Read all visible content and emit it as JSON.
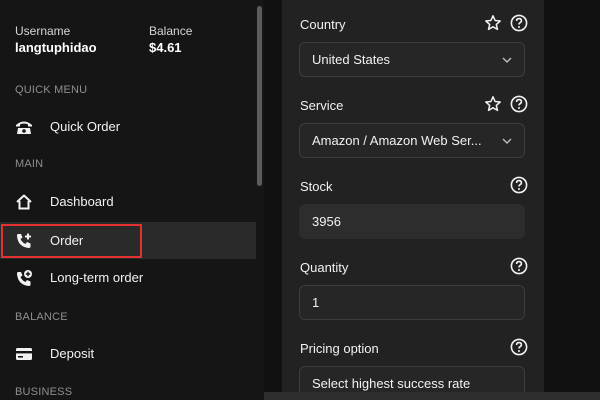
{
  "sidebar": {
    "username_label": "Username",
    "username": "langtuphidao",
    "balance_label": "Balance",
    "balance": "$4.61",
    "sections": {
      "quick_menu": "QUICK MENU",
      "main": "MAIN",
      "balance": "BALANCE",
      "business": "BUSINESS"
    },
    "items": {
      "quick_order": {
        "label": "Quick Order",
        "icon": "phone-icon"
      },
      "dashboard": {
        "label": "Dashboard",
        "icon": "home-icon"
      },
      "order": {
        "label": "Order",
        "icon": "phone-plus-icon"
      },
      "long_term_order": {
        "label": "Long-term order",
        "icon": "phone-add-circle-icon"
      },
      "deposit": {
        "label": "Deposit",
        "icon": "credit-card-icon"
      }
    }
  },
  "form": {
    "country": {
      "label": "Country",
      "value": "United States"
    },
    "service": {
      "label": "Service",
      "value": "Amazon / Amazon Web Ser..."
    },
    "stock": {
      "label": "Stock",
      "value": "3956"
    },
    "quantity": {
      "label": "Quantity",
      "value": "1"
    },
    "pricing": {
      "label": "Pricing option",
      "value": "Select highest success rate"
    }
  },
  "colors": {
    "highlight": "#e5312f",
    "sidebar_bg": "#151515",
    "panel_bg": "#222222"
  }
}
